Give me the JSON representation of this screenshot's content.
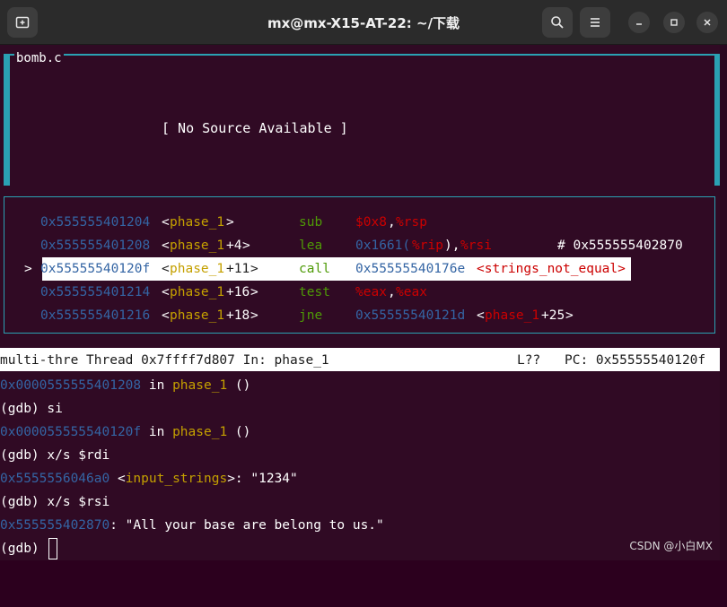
{
  "window": {
    "title": "mx@mx-X15-AT-22: ~/下载"
  },
  "source_pane": {
    "title": "bomb.c",
    "message": "[ No Source Available ]"
  },
  "asm_pane": {
    "rows": [
      {
        "marker": "",
        "addr": "0x555555401204",
        "sym_open": "<",
        "func": "phase_1",
        "off": "",
        "sym_close": ">",
        "op": "sub",
        "arg1": "$0x8",
        "comma1": ",",
        "arg2": "%rsp",
        "extra": "",
        "comment": ""
      },
      {
        "marker": "",
        "addr": "0x555555401208",
        "sym_open": "<",
        "func": "phase_1",
        "off": "+4",
        "sym_close": ">",
        "op": "lea",
        "arg1": "0x1661(",
        "reg1": "%rip",
        "paren": "),",
        "arg2": "%rsi",
        "comment": "# 0x555555402870"
      },
      {
        "marker": ">",
        "addr": "0x55555540120f",
        "sym_open": "<",
        "func": "phase_1",
        "off": "+11",
        "sym_close": ">",
        "op": "call",
        "arg1": "0x55555540176e",
        "target": "<strings_not_equal>"
      },
      {
        "marker": "",
        "addr": "0x555555401214",
        "sym_open": "<",
        "func": "phase_1",
        "off": "+16",
        "sym_close": ">",
        "op": "test",
        "arg1": "%eax",
        "comma1": ",",
        "arg2": "%eax"
      },
      {
        "marker": "",
        "addr": "0x555555401216",
        "sym_open": "<",
        "func": "phase_1",
        "off": "+18",
        "sym_close": ">",
        "op": "jne",
        "arg1": "0x55555540121d",
        "t_open": "<",
        "t_func": "phase_1",
        "t_off": "+25",
        "t_close": ">"
      }
    ]
  },
  "status": {
    "left": "multi-thre Thread 0x7ffff7d807 In: phase_1",
    "line": "L??",
    "pc": "PC: 0x55555540120f"
  },
  "console": {
    "l1_addr": "0x0000555555401208",
    "l1_in": " in ",
    "l1_func": "phase_1",
    "l1_tail": " ()",
    "l2": "(gdb) si",
    "l3_addr": "0x000055555540120f",
    "l3_in": " in ",
    "l3_func": "phase_1",
    "l3_tail": " ()",
    "l4": "(gdb) x/s $rdi",
    "l5_addr": "0x5555556046a0",
    "l5_sym_open": " <",
    "l5_sym": "input_strings",
    "l5_rest": ">: \"1234\"",
    "l6": "(gdb) x/s $rsi",
    "l7_addr": "0x555555402870",
    "l7_rest": ": \"All your base are belong to us.\"",
    "l8": "(gdb) "
  },
  "watermark": "CSDN @小白MX",
  "icons": [
    "new-tab-icon",
    "search-icon",
    "menu-icon",
    "minimize-icon",
    "maximize-icon",
    "close-icon"
  ]
}
